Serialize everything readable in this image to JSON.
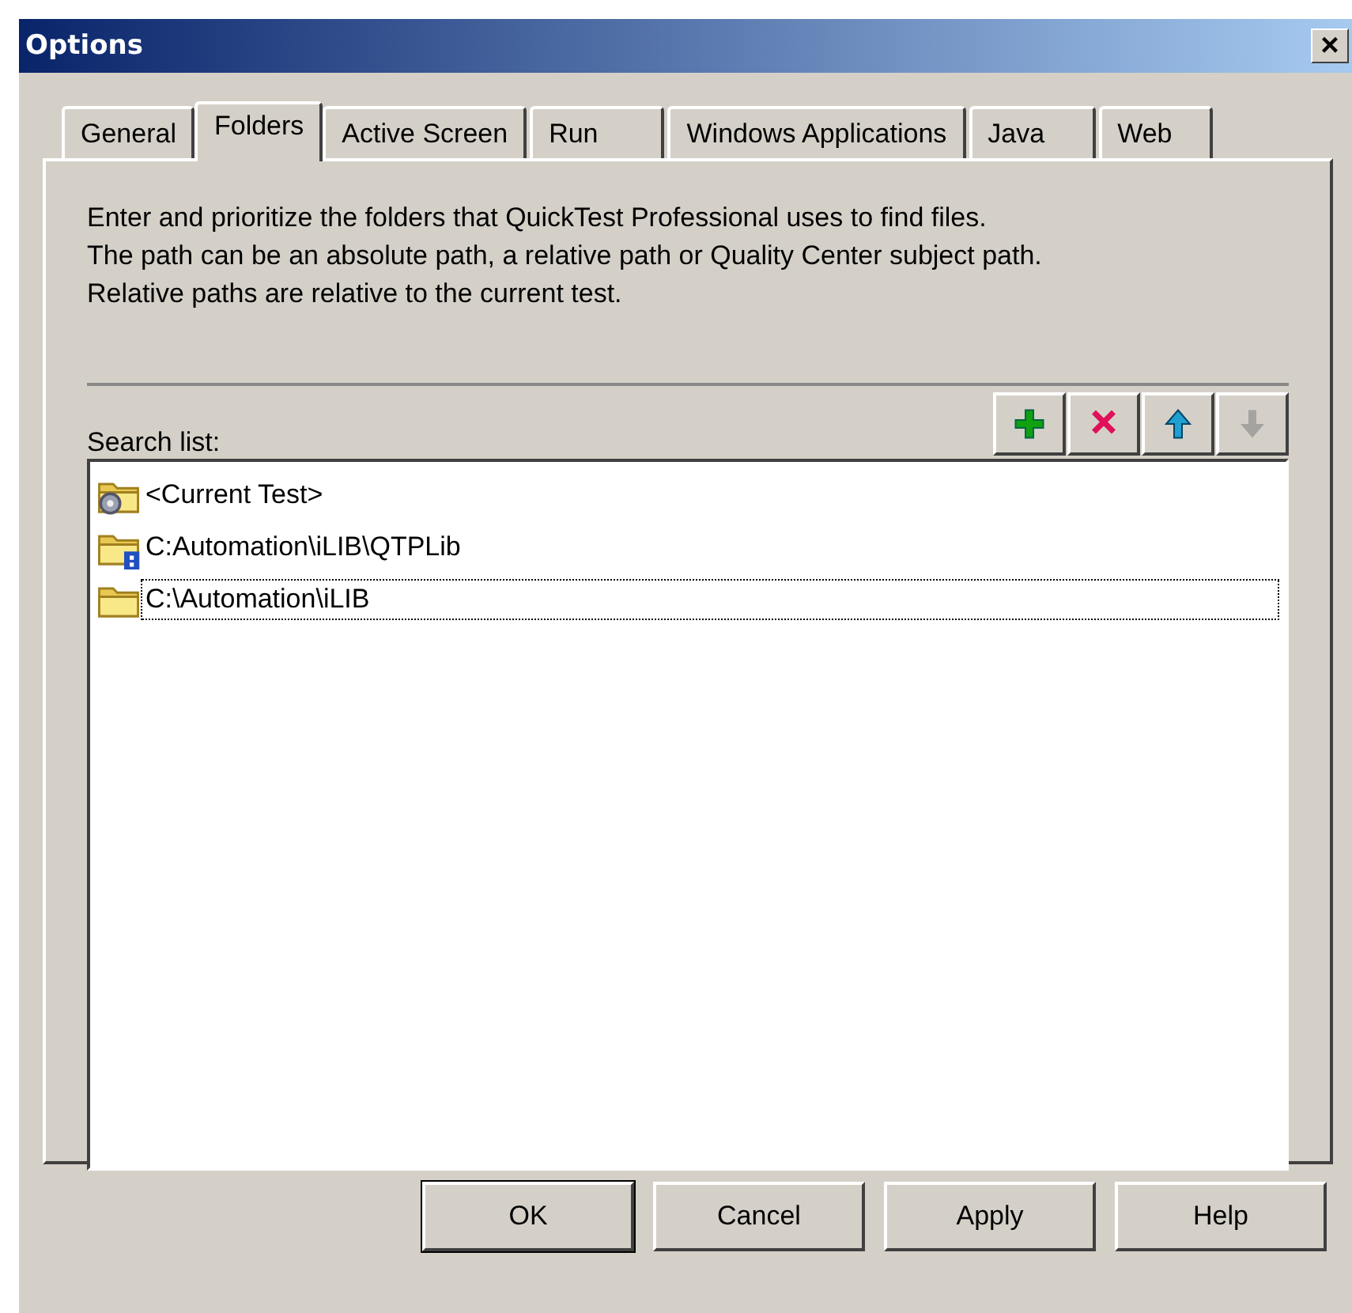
{
  "window": {
    "title": "Options",
    "close": "×"
  },
  "tabs": [
    {
      "label": "General",
      "selected": false
    },
    {
      "label": "Folders",
      "selected": true
    },
    {
      "label": "Active Screen",
      "selected": false
    },
    {
      "label": "Run",
      "selected": false
    },
    {
      "label": "Windows Applications",
      "selected": false
    },
    {
      "label": "Java",
      "selected": false
    },
    {
      "label": "Web",
      "selected": false
    }
  ],
  "description": [
    "Enter and prioritize the folders that QuickTest Professional uses to find files.",
    "The path can be an absolute path, a relative path or Quality Center subject path.",
    "Relative paths are relative to the current test."
  ],
  "search_list": {
    "label": "Search list:",
    "tools": [
      {
        "kind": "add",
        "disabled": false
      },
      {
        "kind": "remove",
        "disabled": false
      },
      {
        "kind": "up",
        "disabled": false
      },
      {
        "kind": "down",
        "disabled": true
      }
    ],
    "items": [
      {
        "kind": "current",
        "text": "<Current Test>",
        "focused": false
      },
      {
        "kind": "qc",
        "text": "C:Automation\\iLIB\\QTPLib",
        "focused": false
      },
      {
        "kind": "folder",
        "text": "C:\\Automation\\iLIB",
        "focused": true
      }
    ]
  },
  "buttons": [
    {
      "label": "OK",
      "default": true
    },
    {
      "label": "Cancel",
      "default": false
    },
    {
      "label": "Apply",
      "default": false
    },
    {
      "label": "Help",
      "default": false
    }
  ]
}
